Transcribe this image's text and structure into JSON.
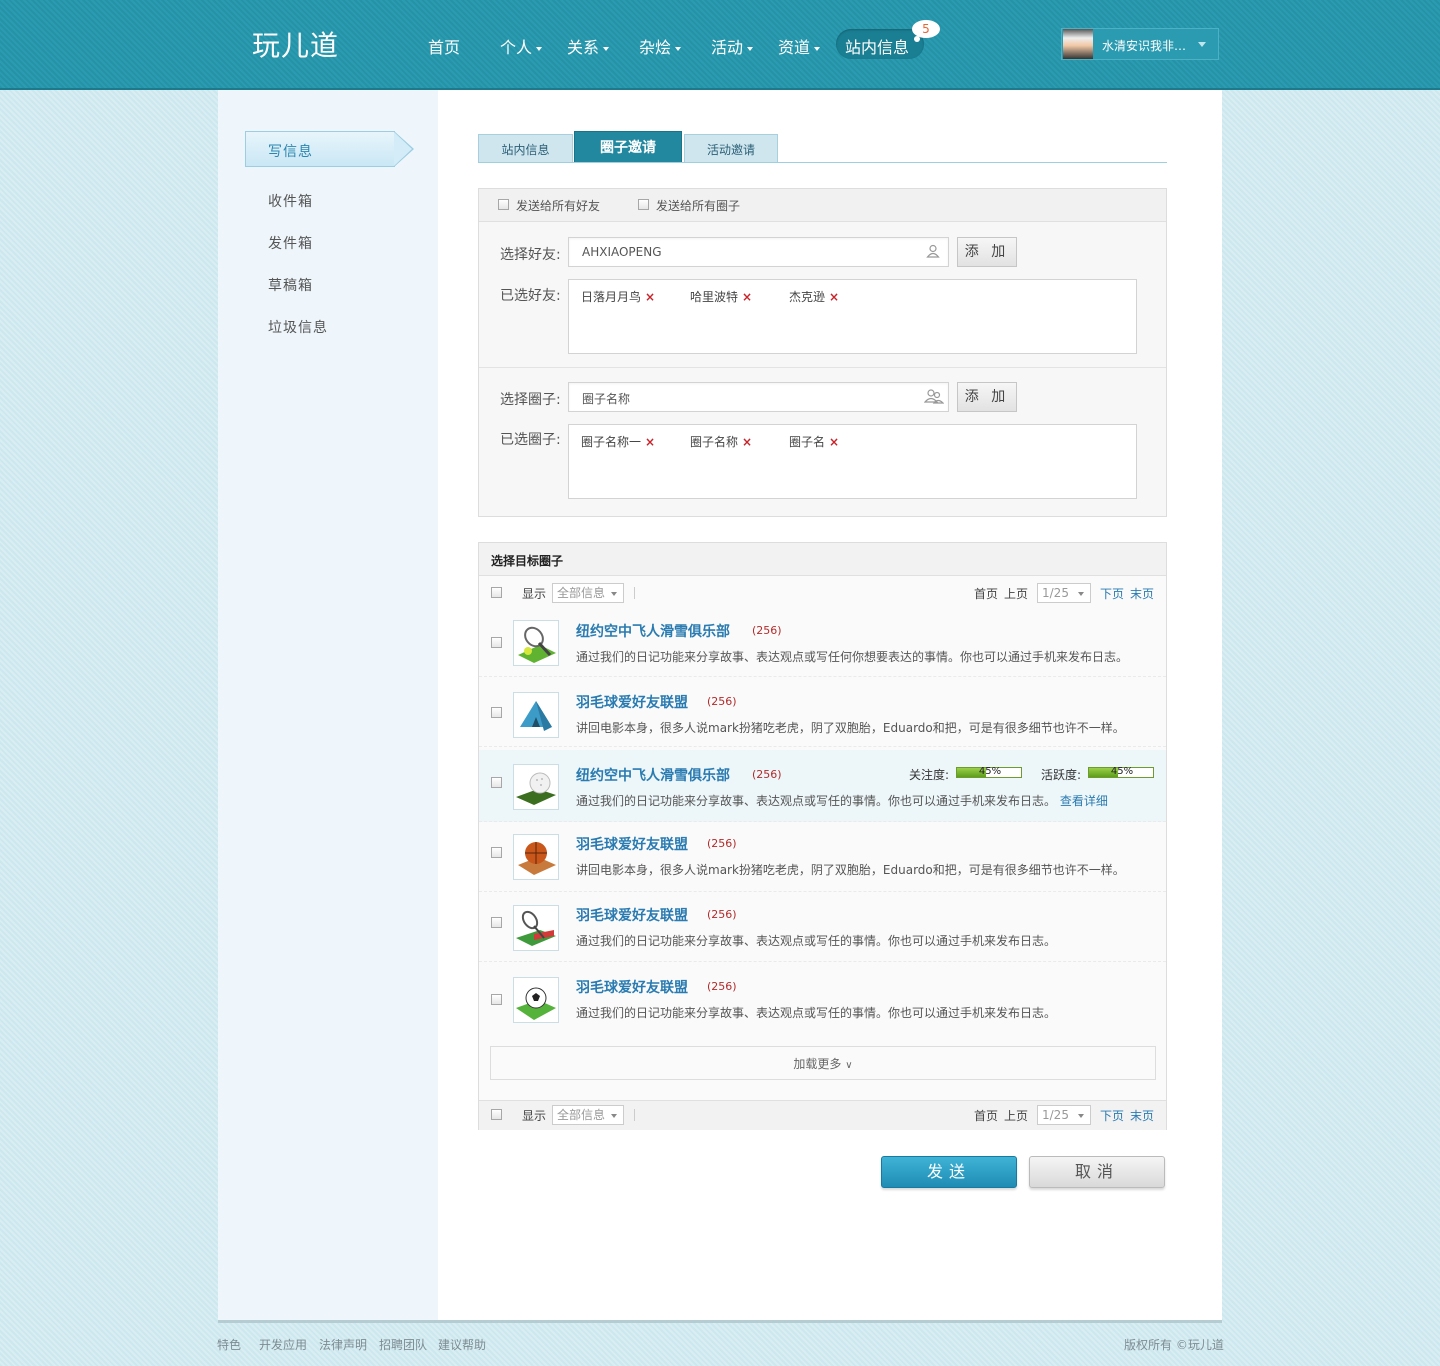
{
  "header": {
    "logo": "玩儿道",
    "nav": [
      "首页",
      "个人",
      "关系",
      "杂烩",
      "活动",
      "资道",
      "站内信息"
    ],
    "message_badge": "5",
    "username": "水清安识我非…"
  },
  "sidebar": {
    "items": [
      "写信息",
      "收件箱",
      "发件箱",
      "草稿箱",
      "垃圾信息"
    ]
  },
  "tabs": [
    "站内信息",
    "圈子邀请",
    "活动邀请"
  ],
  "form": {
    "send_all_friends": "发送给所有好友",
    "send_all_circles": "发送给所有圈子",
    "select_friend_label": "选择好友:",
    "friend_input_value": "AHXIAOPENG",
    "add_label": "添 加",
    "selected_friends_label": "已选好友:",
    "selected_friends": [
      "日落月月鸟",
      "哈里波特",
      "杰克逊"
    ],
    "select_circle_label": "选择圈子:",
    "circle_input_placeholder": "圈子名称",
    "selected_circles_label": "已选圈子:",
    "selected_circles": [
      "圈子名称一",
      "圈子名称",
      "圈子名"
    ]
  },
  "list": {
    "title": "选择目标圈子",
    "show_label": "显示",
    "filter_value": "全部信息",
    "first": "首页",
    "prev": "上页",
    "page_value": "1/25",
    "next": "下页",
    "last": "末页",
    "follow_label": "关注度:",
    "activity_label": "活跃度:",
    "view_detail": "查看详细",
    "load_more": "加载更多",
    "items": [
      {
        "title": "纽约空中飞人滑雪俱乐部",
        "count": "(256)",
        "desc": "通过我们的日记功能来分享故事、表达观点或写任何你想要表达的事情。你也可以通过手机来发布日志。",
        "icon": "tennis-icon"
      },
      {
        "title": "羽毛球爱好友联盟",
        "count": "(256)",
        "desc": "讲回电影本身，很多人说mark扮猪吃老虎，阴了双胞胎，Eduardo和把，可是有很多细节也许不一样。",
        "icon": "tent-icon"
      },
      {
        "title": "纽约空中飞人滑雪俱乐部",
        "count": "(256)",
        "desc": "通过我们的日记功能来分享故事、表达观点或写任的事情。你也可以通过手机来发布日志。",
        "icon": "golf-icon",
        "follow": 45,
        "follow_text": "45%",
        "activity": 45,
        "activity_text": "45%"
      },
      {
        "title": "羽毛球爱好友联盟",
        "count": "(256)",
        "desc": "讲回电影本身，很多人说mark扮猪吃老虎，阴了双胞胎，Eduardo和把，可是有很多细节也许不一样。",
        "icon": "basketball-icon"
      },
      {
        "title": "羽毛球爱好友联盟",
        "count": "(256)",
        "desc": "通过我们的日记功能来分享故事、表达观点或写任的事情。你也可以通过手机来发布日志。",
        "icon": "badminton-icon"
      },
      {
        "title": "羽毛球爱好友联盟",
        "count": "(256)",
        "desc": "通过我们的日记功能来分享故事、表达观点或写任的事情。你也可以通过手机来发布日志。",
        "icon": "soccer-icon"
      }
    ]
  },
  "actions": {
    "send": "发送",
    "cancel": "取消"
  },
  "footer": {
    "links": [
      "特色",
      "开发应用",
      "法律声明",
      "招聘团队",
      "建议帮助"
    ],
    "copyright": "版权所有 ©玩儿道"
  }
}
